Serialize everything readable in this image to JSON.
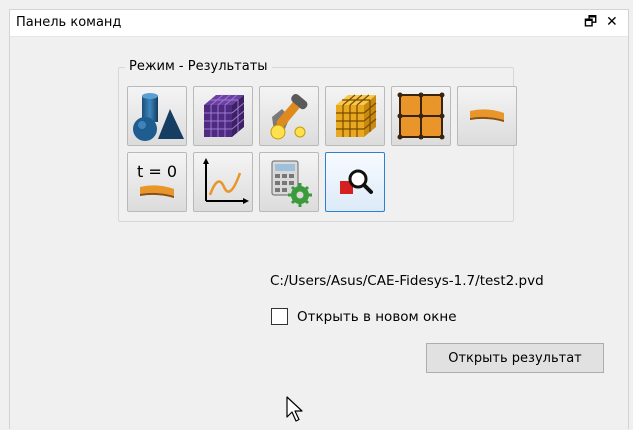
{
  "panel": {
    "title": "Панель команд",
    "float_icon": "float-window-icon",
    "close_icon": "close-icon",
    "float_glyph": "🗗",
    "close_glyph": "✕"
  },
  "mode_group": {
    "label": "Режим - Результаты",
    "buttons": [
      {
        "icon": "geometry-icon"
      },
      {
        "icon": "mesh-icon"
      },
      {
        "icon": "materials-icon"
      },
      {
        "icon": "hex-mesh-icon"
      },
      {
        "icon": "grid-icon"
      },
      {
        "icon": "beam-icon"
      },
      {
        "icon": "initial-conditions-icon",
        "text": "t = 0"
      },
      {
        "icon": "plot-graph-icon"
      },
      {
        "icon": "calculation-settings-icon"
      },
      {
        "icon": "results-view-icon",
        "active": true
      }
    ]
  },
  "file": {
    "path": "C:/Users/Asus/CAE-Fidesys-1.7/test2.pvd"
  },
  "open_new_window": {
    "label": "Открыть в новом окне",
    "checked": false
  },
  "open_result_button": {
    "label": "Открыть результат"
  }
}
